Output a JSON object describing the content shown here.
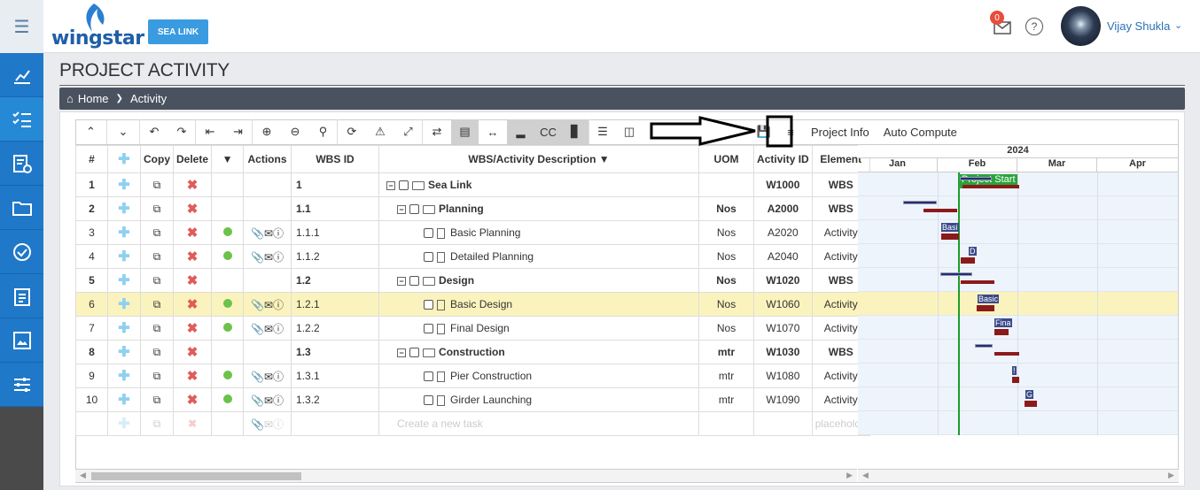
{
  "app": {
    "logo_text": "wingstar",
    "project_button": "SEA LINK",
    "notifications": "0",
    "user_name": "Vijay Shukla"
  },
  "page": {
    "title": "PROJECT ACTIVITY",
    "breadcrumb": [
      "Home",
      "Activity"
    ]
  },
  "toolbar": {
    "project_info": "Project Info",
    "auto_compute": "Auto Compute"
  },
  "columns": [
    "#",
    "",
    "Copy",
    "Delete",
    "",
    "Actions",
    "WBS ID",
    "WBS/Activity Description",
    "UOM",
    "Activity ID",
    "Element"
  ],
  "rows": [
    {
      "num": "1",
      "wbs": "1",
      "desc": "Sea Link",
      "uom": "",
      "aid": "W1000",
      "el": "WBS",
      "type": "wbs",
      "level": 0
    },
    {
      "num": "2",
      "wbs": "1.1",
      "desc": "Planning",
      "uom": "Nos",
      "aid": "A2000",
      "el": "WBS",
      "type": "wbs",
      "level": 1
    },
    {
      "num": "3",
      "wbs": "1.1.1",
      "desc": "Basic Planning",
      "uom": "Nos",
      "aid": "A2020",
      "el": "Activity",
      "type": "activity",
      "level": 2
    },
    {
      "num": "4",
      "wbs": "1.1.2",
      "desc": "Detailed Planning",
      "uom": "Nos",
      "aid": "A2040",
      "el": "Activity",
      "type": "activity",
      "level": 2
    },
    {
      "num": "5",
      "wbs": "1.2",
      "desc": "Design",
      "uom": "Nos",
      "aid": "W1020",
      "el": "WBS",
      "type": "wbs",
      "level": 1
    },
    {
      "num": "6",
      "wbs": "1.2.1",
      "desc": "Basic Design",
      "uom": "Nos",
      "aid": "W1060",
      "el": "Activity",
      "type": "activity",
      "level": 2,
      "selected": true
    },
    {
      "num": "7",
      "wbs": "1.2.2",
      "desc": "Final Design",
      "uom": "Nos",
      "aid": "W1070",
      "el": "Activity",
      "type": "activity",
      "level": 2
    },
    {
      "num": "8",
      "wbs": "1.3",
      "desc": "Construction",
      "uom": "mtr",
      "aid": "W1030",
      "el": "WBS",
      "type": "wbs",
      "level": 1
    },
    {
      "num": "9",
      "wbs": "1.3.1",
      "desc": "Pier Construction",
      "uom": "mtr",
      "aid": "W1080",
      "el": "Activity",
      "type": "activity",
      "level": 2
    },
    {
      "num": "10",
      "wbs": "1.3.2",
      "desc": "Girder Launching",
      "uom": "mtr",
      "aid": "W1090",
      "el": "Activity",
      "type": "activity",
      "level": 2
    }
  ],
  "new_row": {
    "desc_placeholder": "Create a new task",
    "element_placeholder": "placeholde"
  },
  "gantt": {
    "year": "2024",
    "months": [
      "Jan",
      "Feb",
      "Mar",
      "Apr"
    ],
    "project_start": "Project Start",
    "bar_labels": {
      "row3": "Basi",
      "row4": "D",
      "row6": "Basic",
      "row7": "Fina",
      "row9": "!",
      "row10": "G"
    }
  },
  "colors": {
    "accent": "#1f78c8",
    "selected_row": "#fbf3bd",
    "today_line": "#1f9a2c"
  }
}
